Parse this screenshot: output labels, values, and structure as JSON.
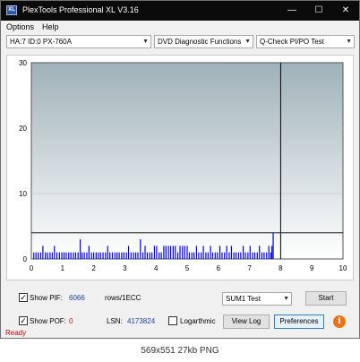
{
  "window": {
    "title": "PlexTools Professional XL V3.16",
    "icon_text": "XL"
  },
  "menu": [
    "Options",
    "Help"
  ],
  "toolbar": {
    "drive": "HA:7 ID:0  PX-760A",
    "function": "DVD Diagnostic Functions",
    "test": "Q-Check PI/PO Test"
  },
  "chart_data": {
    "type": "bar",
    "xlim": [
      0,
      10
    ],
    "ylim": [
      0,
      30
    ],
    "x_ticks": [
      "0",
      "1",
      "2",
      "3",
      "4",
      "5",
      "6",
      "7",
      "8",
      "9",
      "10"
    ],
    "y_ticks": [
      "0",
      "10",
      "20",
      "30"
    ],
    "threshold": 4,
    "marker_x": 8,
    "bar_color": "#0000ff",
    "series": [
      {
        "x": [
          0.08,
          0.15,
          0.22,
          0.3,
          0.37,
          0.45,
          0.52,
          0.6,
          0.67,
          0.74,
          0.82,
          0.9,
          0.98,
          1.05,
          1.12,
          1.2,
          1.27,
          1.35,
          1.42,
          1.5,
          1.57,
          1.63,
          1.7,
          1.78,
          1.85,
          1.93,
          2.0,
          2.08,
          2.15,
          2.22,
          2.3,
          2.38,
          2.45,
          2.52,
          2.6,
          2.68,
          2.75,
          2.82,
          2.9,
          2.97,
          3.05,
          3.12,
          3.2,
          3.28,
          3.35,
          3.42,
          3.5,
          3.58,
          3.65,
          3.72,
          3.8,
          3.87,
          3.95,
          4.02,
          4.1,
          4.17,
          4.25,
          4.32,
          4.4,
          4.47,
          4.55,
          4.62,
          4.7,
          4.77,
          4.85,
          4.92,
          5.0,
          5.07,
          5.15,
          5.22,
          5.3,
          5.37,
          5.45,
          5.52,
          5.6,
          5.67,
          5.75,
          5.82,
          5.9,
          5.97,
          6.05,
          6.12,
          6.2,
          6.27,
          6.35,
          6.42,
          6.5,
          6.57,
          6.65,
          6.72,
          6.8,
          6.87,
          6.95,
          7.02,
          7.1,
          7.17,
          7.25,
          7.32,
          7.4,
          7.47,
          7.55,
          7.62,
          7.68,
          7.72,
          7.76
        ],
        "values": [
          1,
          1,
          1,
          1,
          2,
          1,
          1,
          1,
          1,
          2,
          1,
          1,
          1,
          1,
          1,
          1,
          1,
          1,
          1,
          1,
          3,
          1,
          1,
          1,
          2,
          1,
          1,
          1,
          1,
          1,
          1,
          1,
          2,
          1,
          1,
          1,
          1,
          1,
          1,
          1,
          1,
          2,
          1,
          1,
          1,
          1,
          3,
          1,
          2,
          1,
          1,
          1,
          2,
          2,
          1,
          1,
          2,
          2,
          2,
          2,
          2,
          2,
          1,
          2,
          2,
          2,
          2,
          1,
          1,
          1,
          2,
          1,
          1,
          2,
          1,
          1,
          2,
          1,
          1,
          1,
          2,
          1,
          1,
          2,
          1,
          2,
          1,
          1,
          1,
          1,
          2,
          1,
          1,
          2,
          1,
          1,
          1,
          2,
          1,
          1,
          1,
          2,
          1,
          2,
          4
        ]
      }
    ]
  },
  "controls": {
    "show_pif_label": "Show PIF:",
    "pif_value": "6066",
    "pif_unit": "rows/1ECC",
    "show_pof_label": "Show POF:",
    "pof_value": "0",
    "lsn_label": "LSN:",
    "lsn_value": "4173824",
    "logarithmic_label": "Logarthmic",
    "sum_select": "SUM1 Test",
    "start_label": "Start",
    "view_log_label": "View Log",
    "preferences_label": "Preferences",
    "info_icon": "i",
    "check_mark": "✓"
  },
  "status": {
    "text": "Ready",
    "color": "#d00000"
  },
  "caption": "569x551  27kb  PNG"
}
